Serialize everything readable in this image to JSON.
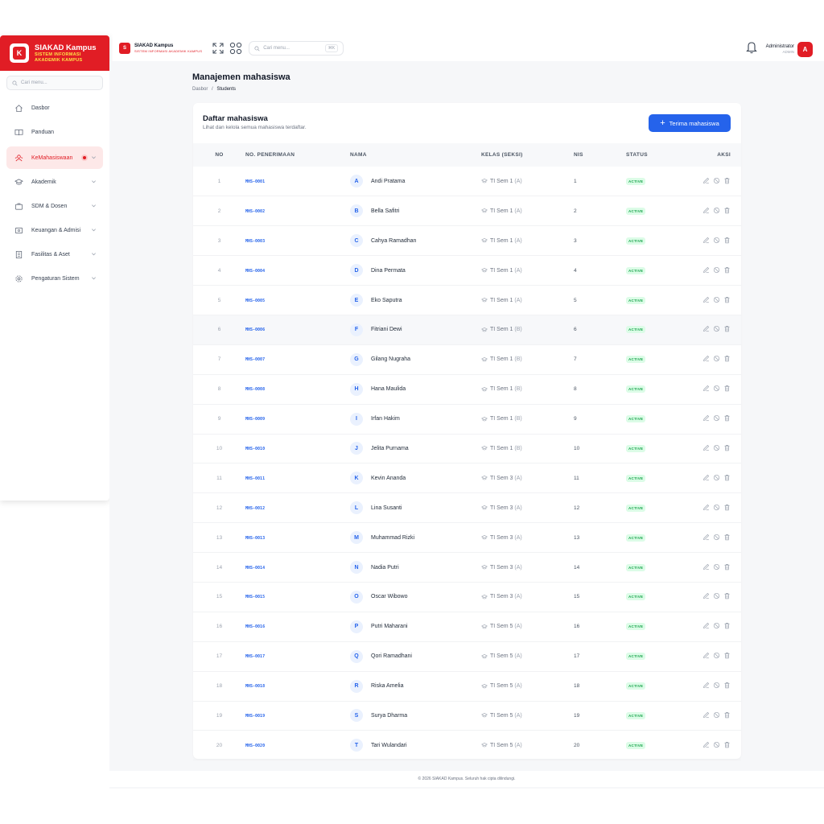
{
  "sidebar": {
    "brand_title": "SIAKAD Kampus",
    "brand_sub_1": "SISTEM INFORMASI",
    "brand_sub_2": "AKADEMIK KAMPUS",
    "logo_letter": "K",
    "search_placeholder": "Cari menu...",
    "items": [
      {
        "label": "Dasbor",
        "icon": "home-icon"
      },
      {
        "label": "Panduan",
        "icon": "book-icon"
      },
      {
        "label": "KeMahasiswaan",
        "icon": "users-icon",
        "active": true
      },
      {
        "label": "Akademik",
        "icon": "graduation-cap-icon"
      },
      {
        "label": "SDM & Dosen",
        "icon": "briefcase-icon"
      },
      {
        "label": "Keuangan & Admisi",
        "icon": "wallet-icon"
      },
      {
        "label": "Fasilitas & Aset",
        "icon": "building-icon"
      },
      {
        "label": "Pengaturan Sistem",
        "icon": "gear-icon"
      }
    ]
  },
  "topbar": {
    "logo_letter": "S",
    "brand_title": "SIAKAD Kampus",
    "brand_sub": "SISTEM INFORMASI AKADEMIK KAMPUS",
    "search_placeholder": "Cari menu...",
    "shortcut": "⌘K",
    "user_name": "Administrator",
    "user_role": "ADMIN",
    "avatar_letter": "A"
  },
  "page": {
    "title": "Manajemen mahasiswa",
    "breadcrumb_home": "Dasbor",
    "breadcrumb_sep": "/",
    "breadcrumb_current": "Students"
  },
  "card": {
    "title": "Daftar mahasiswa",
    "subtitle": "Lihat dan kelola semua mahasiswa terdaftar.",
    "primary_button": "Terima mahasiswa"
  },
  "table": {
    "headers": [
      "NO",
      "NO. PENERIMAAN",
      "NAMA",
      "KELAS (SEKSI)",
      "NIS",
      "STATUS",
      "AKSI"
    ],
    "rows": [
      {
        "no": "1",
        "reg": "MHS-0001",
        "initial": "A",
        "name": "Andi Pratama",
        "kelas": "TI Sem 1",
        "seksi": "(A)",
        "nis": "1",
        "status": "ACTIVE"
      },
      {
        "no": "2",
        "reg": "MHS-0002",
        "initial": "B",
        "name": "Bella Safitri",
        "kelas": "TI Sem 1",
        "seksi": "(A)",
        "nis": "2",
        "status": "ACTIVE"
      },
      {
        "no": "3",
        "reg": "MHS-0003",
        "initial": "C",
        "name": "Cahya Ramadhan",
        "kelas": "TI Sem 1",
        "seksi": "(A)",
        "nis": "3",
        "status": "ACTIVE"
      },
      {
        "no": "4",
        "reg": "MHS-0004",
        "initial": "D",
        "name": "Dina Permata",
        "kelas": "TI Sem 1",
        "seksi": "(A)",
        "nis": "4",
        "status": "ACTIVE"
      },
      {
        "no": "5",
        "reg": "MHS-0005",
        "initial": "E",
        "name": "Eko Saputra",
        "kelas": "TI Sem 1",
        "seksi": "(A)",
        "nis": "5",
        "status": "ACTIVE"
      },
      {
        "no": "6",
        "reg": "MHS-0006",
        "initial": "F",
        "name": "Fitriani Dewi",
        "kelas": "TI Sem 1",
        "seksi": "(B)",
        "nis": "6",
        "status": "ACTIVE"
      },
      {
        "no": "7",
        "reg": "MHS-0007",
        "initial": "G",
        "name": "Gilang Nugraha",
        "kelas": "TI Sem 1",
        "seksi": "(B)",
        "nis": "7",
        "status": "ACTIVE"
      },
      {
        "no": "8",
        "reg": "MHS-0008",
        "initial": "H",
        "name": "Hana Maulida",
        "kelas": "TI Sem 1",
        "seksi": "(B)",
        "nis": "8",
        "status": "ACTIVE"
      },
      {
        "no": "9",
        "reg": "MHS-0009",
        "initial": "I",
        "name": "Irfan Hakim",
        "kelas": "TI Sem 1",
        "seksi": "(B)",
        "nis": "9",
        "status": "ACTIVE"
      },
      {
        "no": "10",
        "reg": "MHS-0010",
        "initial": "J",
        "name": "Jelita Purnama",
        "kelas": "TI Sem 1",
        "seksi": "(B)",
        "nis": "10",
        "status": "ACTIVE"
      },
      {
        "no": "11",
        "reg": "MHS-0011",
        "initial": "K",
        "name": "Kevin Ananda",
        "kelas": "TI Sem 3",
        "seksi": "(A)",
        "nis": "11",
        "status": "ACTIVE"
      },
      {
        "no": "12",
        "reg": "MHS-0012",
        "initial": "L",
        "name": "Lina Susanti",
        "kelas": "TI Sem 3",
        "seksi": "(A)",
        "nis": "12",
        "status": "ACTIVE"
      },
      {
        "no": "13",
        "reg": "MHS-0013",
        "initial": "M",
        "name": "Muhammad Rizki",
        "kelas": "TI Sem 3",
        "seksi": "(A)",
        "nis": "13",
        "status": "ACTIVE"
      },
      {
        "no": "14",
        "reg": "MHS-0014",
        "initial": "N",
        "name": "Nadia Putri",
        "kelas": "TI Sem 3",
        "seksi": "(A)",
        "nis": "14",
        "status": "ACTIVE"
      },
      {
        "no": "15",
        "reg": "MHS-0015",
        "initial": "O",
        "name": "Oscar Wibowo",
        "kelas": "TI Sem 3",
        "seksi": "(A)",
        "nis": "15",
        "status": "ACTIVE"
      },
      {
        "no": "16",
        "reg": "MHS-0016",
        "initial": "P",
        "name": "Putri Maharani",
        "kelas": "TI Sem 5",
        "seksi": "(A)",
        "nis": "16",
        "status": "ACTIVE"
      },
      {
        "no": "17",
        "reg": "MHS-0017",
        "initial": "Q",
        "name": "Qori Ramadhani",
        "kelas": "TI Sem 5",
        "seksi": "(A)",
        "nis": "17",
        "status": "ACTIVE"
      },
      {
        "no": "18",
        "reg": "MHS-0018",
        "initial": "R",
        "name": "Riska Amelia",
        "kelas": "TI Sem 5",
        "seksi": "(A)",
        "nis": "18",
        "status": "ACTIVE"
      },
      {
        "no": "19",
        "reg": "MHS-0019",
        "initial": "S",
        "name": "Surya Dharma",
        "kelas": "TI Sem 5",
        "seksi": "(A)",
        "nis": "19",
        "status": "ACTIVE"
      },
      {
        "no": "20",
        "reg": "MHS-0020",
        "initial": "T",
        "name": "Tari Wulandari",
        "kelas": "TI Sem 5",
        "seksi": "(A)",
        "nis": "20",
        "status": "ACTIVE"
      }
    ]
  },
  "footer": {
    "text": "© 2026 SIAKAD Kampus. Seluruh hak cipta dilindungi."
  },
  "colors": {
    "brand_red": "#e11d25",
    "primary_blue": "#2563eb",
    "status_green": "#16a34a"
  }
}
